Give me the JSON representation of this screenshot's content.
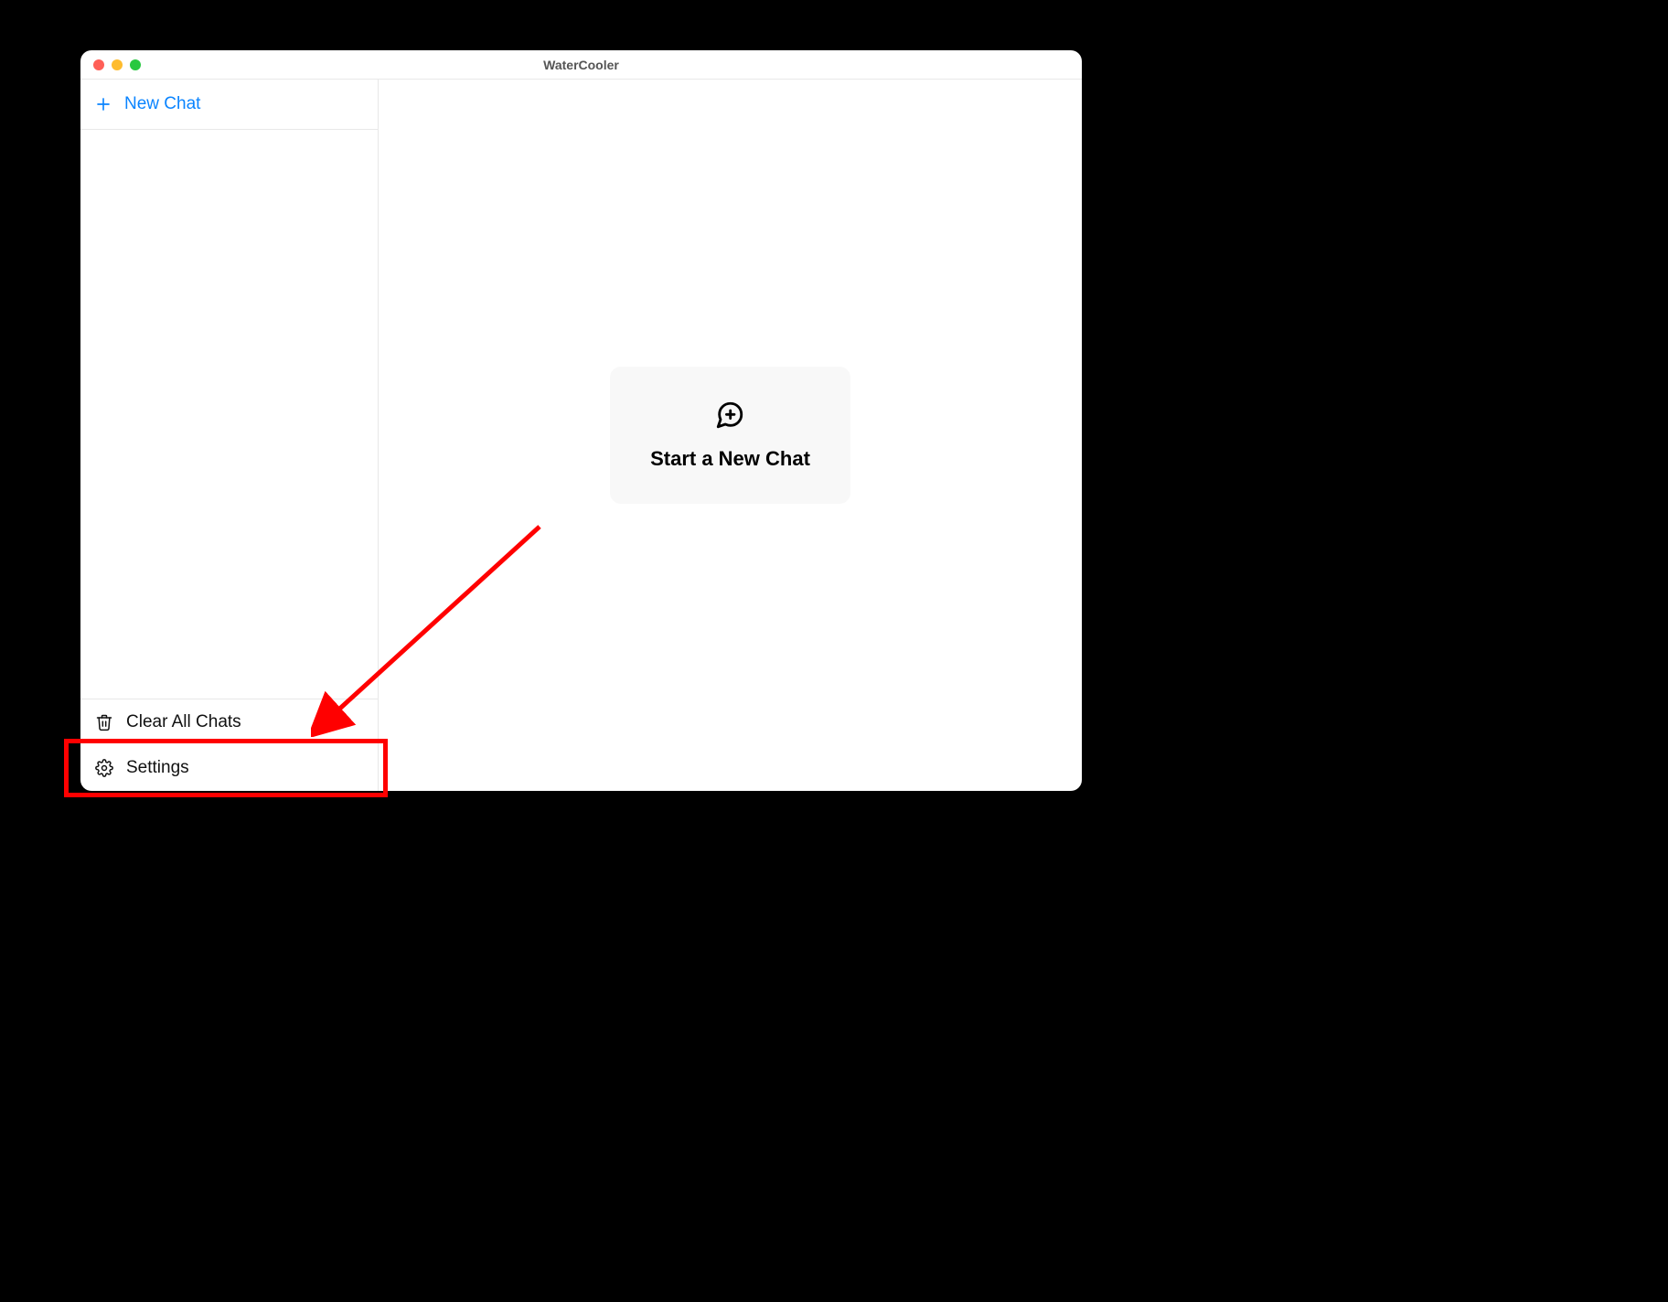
{
  "window": {
    "title": "WaterCooler"
  },
  "sidebar": {
    "new_chat_label": "New Chat",
    "footer": {
      "clear_all_label": "Clear All Chats",
      "settings_label": "Settings"
    }
  },
  "main": {
    "start_card_label": "Start a New Chat"
  },
  "annotation": {
    "target": "settings-item",
    "color": "#ff0000"
  }
}
